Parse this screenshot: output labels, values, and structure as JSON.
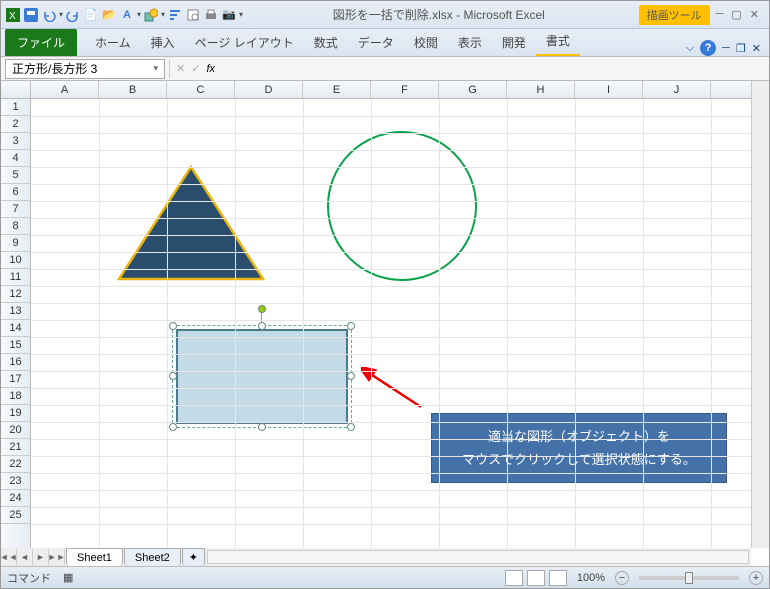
{
  "title": {
    "filename": "図形を一括で削除.xlsx",
    "app": "Microsoft Excel",
    "sep": " - "
  },
  "tool_context": {
    "label": "描画ツール"
  },
  "tabs": {
    "file": "ファイル",
    "home": "ホーム",
    "insert": "挿入",
    "pagelayout": "ページ レイアウト",
    "formulas": "数式",
    "data": "データ",
    "review": "校閲",
    "view": "表示",
    "developer": "開発",
    "format": "書式"
  },
  "namebox": {
    "value": "正方形/長方形 3",
    "dropdown": "▾"
  },
  "fx": {
    "label": "fx"
  },
  "columns": [
    "A",
    "B",
    "C",
    "D",
    "E",
    "F",
    "G",
    "H",
    "I",
    "J"
  ],
  "rows": [
    "1",
    "2",
    "3",
    "4",
    "5",
    "6",
    "7",
    "8",
    "9",
    "10",
    "11",
    "12",
    "13",
    "14",
    "15",
    "16",
    "17",
    "18",
    "19",
    "20",
    "21",
    "22",
    "23",
    "24",
    "25"
  ],
  "callout": {
    "line1": "適当な図形（オブジェクト）を",
    "line2": "マウスでクリックして選択状態にする。"
  },
  "sheets": {
    "nav": [
      "◄◄",
      "◄",
      "►",
      "►►"
    ],
    "s1": "Sheet1",
    "s2": "Sheet2"
  },
  "status": {
    "mode": "コマンド",
    "zoom": "100%",
    "minus": "−",
    "plus": "+"
  },
  "help": {
    "q": "?"
  },
  "icons": {
    "caret": "▾"
  }
}
